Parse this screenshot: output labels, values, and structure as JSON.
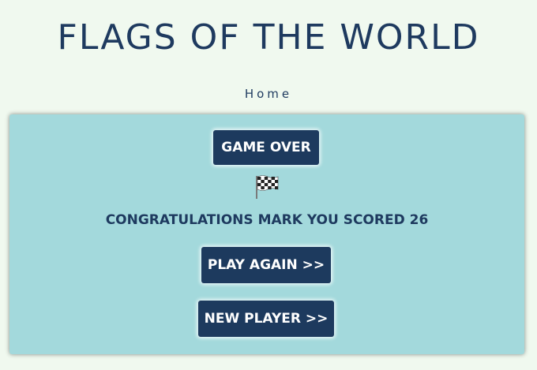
{
  "header": {
    "title": "FLAGS OF THE WORLD"
  },
  "nav": {
    "home_label": "Home"
  },
  "panel": {
    "game_over_label": "GAME OVER",
    "flag_icon": "checkered-flag",
    "result_text": "CONGRATULATIONS MARK YOU SCORED 26",
    "play_again_label": "PLAY AGAIN >>",
    "new_player_label": "NEW PLAYER >>"
  },
  "colors": {
    "background": "#f0f9ef",
    "panel": "#a3d9dc",
    "button": "#1d3a5e",
    "text": "#1e3a5f"
  }
}
